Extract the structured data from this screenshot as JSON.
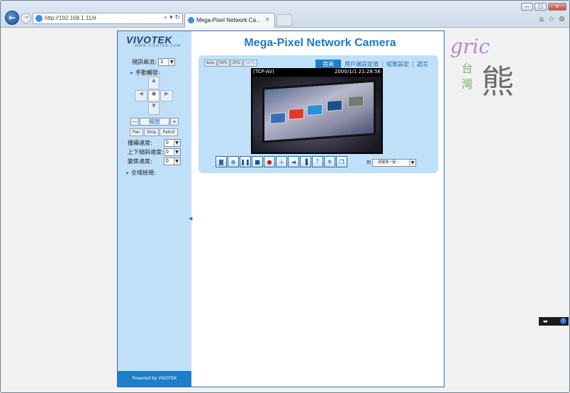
{
  "browser": {
    "url": "http://192.168.1.11/#",
    "url_controls": "⌕ ▾ ↻",
    "tab_title": "Mega-Pixel Network Ca...",
    "tab_close": "×",
    "window_buttons": [
      "—",
      "□",
      "×"
    ],
    "tool_icons": [
      "home-icon",
      "star-icon",
      "gear-icon"
    ]
  },
  "sidebar": {
    "logo_text": "VIVOTEK",
    "logo_tagline": "WWW.VIVOTEK.COM",
    "stream_label": "視訊串流:",
    "stream_value": "1",
    "manual_label": "手動觸發:",
    "zoom_minus": "—",
    "zoom_label": "縮放",
    "zoom_plus": "+",
    "buttons": [
      "Pan",
      "Stop",
      "Patrol"
    ],
    "speeds": [
      {
        "label": "播攝速度:",
        "value": "0"
      },
      {
        "label": "上下傾斜速度:",
        "value": "0"
      },
      {
        "label": "變焦速度:",
        "value": "0"
      }
    ],
    "global_label": "全域檢視:",
    "powered_by": "Powered by VIVOTEK"
  },
  "header": {
    "title": "Mega-Pixel Network Camera"
  },
  "nav": {
    "items": [
      "首頁",
      "用戶端設定值",
      "組態設定",
      "語言"
    ],
    "active": "首頁"
  },
  "size_buttons": [
    "Auto",
    "50%",
    "25%",
    "100%"
  ],
  "video": {
    "protocol": "(TCP-AV)",
    "timestamp": "2000/1/1 21:28:56"
  },
  "controls": {
    "icons": [
      "camera-icon",
      "zoom-icon",
      "pause-icon",
      "stop-icon",
      "record-icon",
      "download-icon",
      "speaker-icon",
      "volume-icon",
      "upload-icon",
      "microphone-icon",
      "fullscreen-icon"
    ],
    "preset_label": "到",
    "preset_value": "-- 請選擇一個 --"
  },
  "watermark": {
    "script": "gric",
    "line1": "台",
    "line2": "灣",
    "big": "熊"
  },
  "help_button": "?"
}
